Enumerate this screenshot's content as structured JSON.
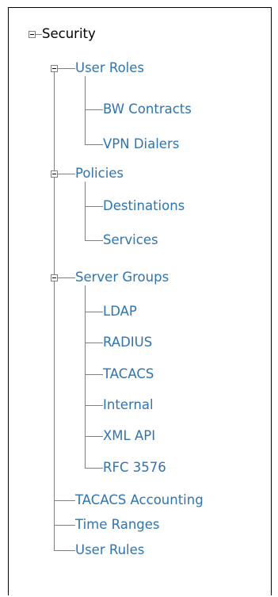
{
  "tree": {
    "root": {
      "label": "Security"
    },
    "user_roles": {
      "label": "User Roles",
      "children": [
        "BW Contracts",
        "VPN Dialers"
      ]
    },
    "policies": {
      "label": "Policies",
      "children": [
        "Destinations",
        "Services"
      ]
    },
    "server_groups": {
      "label": "Server Groups",
      "children": [
        "LDAP",
        "RADIUS",
        "TACACS",
        "Internal",
        "XML API",
        "RFC 3576"
      ]
    },
    "tacacs_accounting": {
      "label": "TACACS Accounting"
    },
    "time_ranges": {
      "label": "Time Ranges"
    },
    "user_rules": {
      "label": "User Rules"
    }
  },
  "colors": {
    "link": "#2e74b5",
    "connector": "#808080",
    "border": "#000000"
  }
}
